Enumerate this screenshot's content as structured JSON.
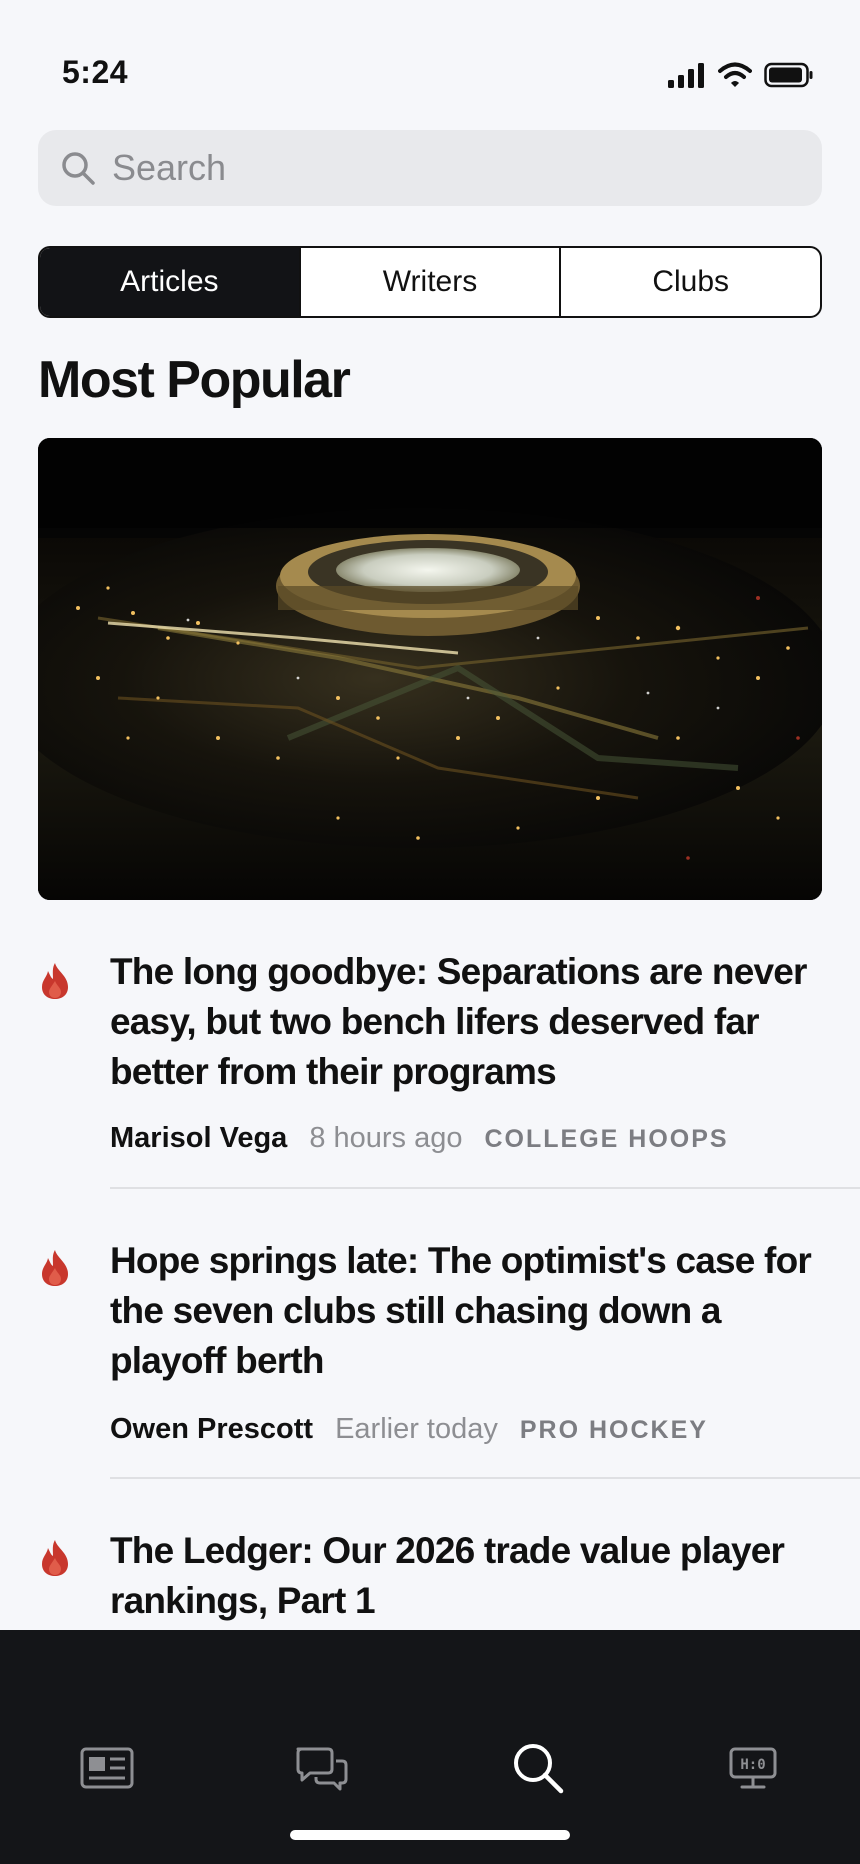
{
  "status_bar": {
    "time": "5:24"
  },
  "search": {
    "placeholder": "Search"
  },
  "segments": [
    {
      "label": "Articles",
      "active": true
    },
    {
      "label": "Writers",
      "active": false
    },
    {
      "label": "Clubs",
      "active": false
    }
  ],
  "section": {
    "title": "Most Popular"
  },
  "articles": [
    {
      "headline": "The long goodbye: Separations are never easy, but two bench lifers deserved far better from their programs",
      "author": "Marisol Vega",
      "time": "8 hours ago",
      "category": "COLLEGE HOOPS"
    },
    {
      "headline": "Hope springs late: The optimist's case for the seven clubs still chasing down a playoff berth",
      "author": "Owen Prescott",
      "time": "Earlier today",
      "category": "PRO HOCKEY"
    },
    {
      "headline": "The Ledger: Our 2026 trade value player rankings, Part 1"
    }
  ],
  "tab_bar": {
    "items": [
      {
        "icon": "newspaper-icon",
        "active": false
      },
      {
        "icon": "chat-bubbles-icon",
        "active": false
      },
      {
        "icon": "search-icon",
        "active": true
      },
      {
        "icon": "scoreboard-icon",
        "active": false
      }
    ]
  },
  "colors": {
    "flame": "#c8372d",
    "active_segment": "#121316",
    "tab_bar_bg": "#141518",
    "page_bg": "#f6f7fa"
  }
}
